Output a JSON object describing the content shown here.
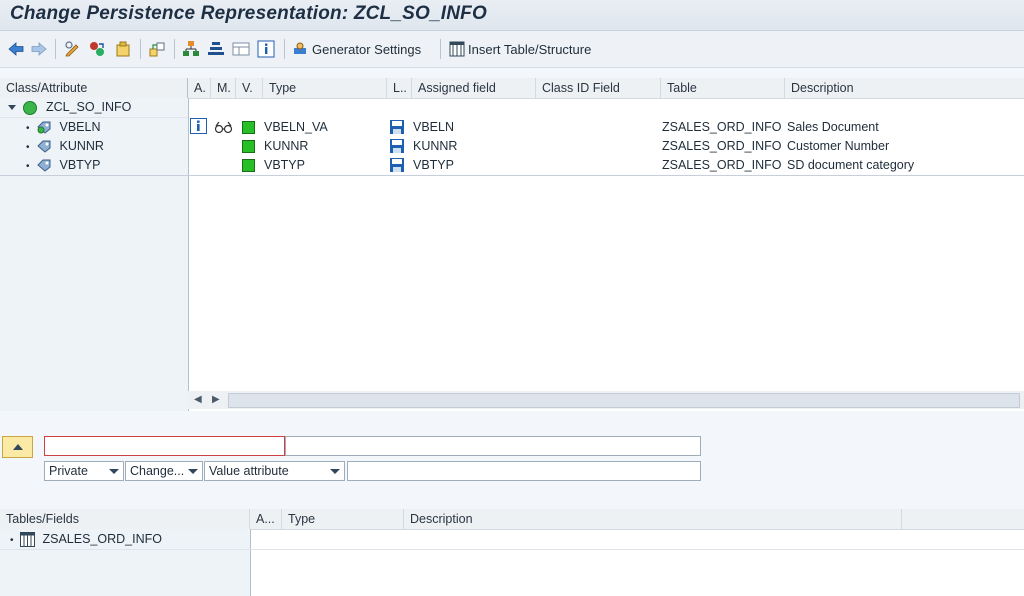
{
  "title": "Change Persistence Representation: ZCL_SO_INFO",
  "toolbar": {
    "icons": [
      "back-icon",
      "forward-icon",
      "display-change-icon",
      "activate-icon",
      "class-icon",
      "other-object-icon",
      "hierarchy-icon",
      "align-icon",
      "layout-icon",
      "info-icon"
    ],
    "generator_settings": "Generator Settings",
    "insert_table": "Insert Table/Structure"
  },
  "tree": {
    "headers": {
      "class_attribute": "Class/Attribute",
      "a": "A.",
      "m": "M.",
      "v": "V.",
      "type": "Type",
      "l": "L..",
      "assigned_field": "Assigned field",
      "class_id_field": "Class ID Field",
      "table": "Table",
      "description": "Description"
    },
    "root": "ZCL_SO_INFO",
    "attributes": [
      {
        "name": "VBELN",
        "type": "VBELN_VA",
        "field": "VBELN",
        "table": "ZSALES_ORD_INFO",
        "description": "Sales Document"
      },
      {
        "name": "KUNNR",
        "type": "KUNNR",
        "field": "KUNNR",
        "table": "ZSALES_ORD_INFO",
        "description": "Customer Number"
      },
      {
        "name": "VBTYP",
        "type": "VBTYP",
        "field": "VBTYP",
        "table": "ZSALES_ORD_INFO",
        "description": "SD document category"
      }
    ]
  },
  "editor": {
    "name_value": "",
    "description_value": "",
    "visibility": "Private",
    "changeable": "Change...",
    "attribute_kind": "Value attribute",
    "extra_value": ""
  },
  "tables": {
    "headers": {
      "tables_fields": "Tables/Fields",
      "a": "A...",
      "type": "Type",
      "description": "Description"
    },
    "items": [
      "ZSALES_ORD_INFO"
    ]
  },
  "colors": {
    "accent": "#1f77c8",
    "green": "#26c026"
  }
}
